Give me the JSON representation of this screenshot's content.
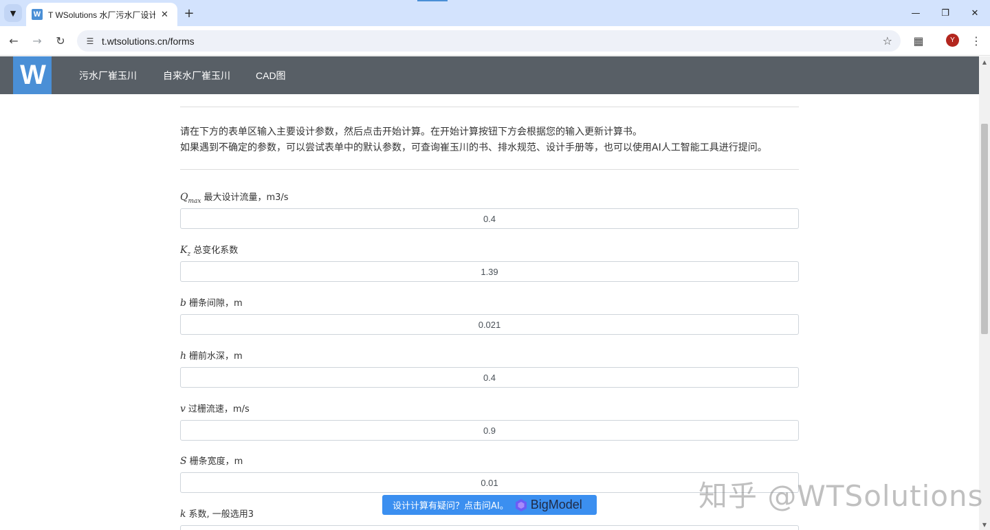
{
  "browser": {
    "tab_title": "T WSolutions 水厂污水厂设计",
    "favicon_letter": "W",
    "url": "t.wtsolutions.cn/forms",
    "avatar_letter": "Y"
  },
  "site": {
    "logo_text": "W",
    "nav": [
      "污水厂崔玉川",
      "自来水厂崔玉川",
      "CAD图"
    ]
  },
  "intro": {
    "line1": "请在下方的表单区输入主要设计参数，然后点击开始计算。在开始计算按钮下方会根据您的输入更新计算书。",
    "line2": "如果遇到不确定的参数，可以尝试表单中的默认参数，可查询崔玉川的书、排水规范、设计手册等，也可以使用AI人工智能工具进行提问。"
  },
  "fields": [
    {
      "symbol": "Q",
      "sub": "max",
      "label": "最大设计流量，m3/s",
      "value": "0.4"
    },
    {
      "symbol": "K",
      "sub": "z",
      "label": "总变化系数",
      "value": "1.39"
    },
    {
      "symbol": "b",
      "sub": "",
      "label": "栅条间隙，m",
      "value": "0.021"
    },
    {
      "symbol": "h",
      "sub": "",
      "label": "栅前水深，m",
      "value": "0.4"
    },
    {
      "symbol": "v",
      "sub": "",
      "label": "过栅流速，m/s",
      "value": "0.9"
    },
    {
      "symbol": "S",
      "sub": "",
      "label": "栅条宽度，m",
      "value": "0.01"
    },
    {
      "symbol": "k",
      "sub": "",
      "label": "系数, 一般选用3",
      "value": ""
    }
  ],
  "ai_button": {
    "label": "设计计算有疑问？点击问AI。",
    "brand": "BigModel"
  },
  "watermark": "知乎 @WTSolutions",
  "colors": {
    "nav_bg": "#585f66",
    "logo_bg": "#4a8fd6",
    "ai_button_bg": "#3b8ff0"
  }
}
